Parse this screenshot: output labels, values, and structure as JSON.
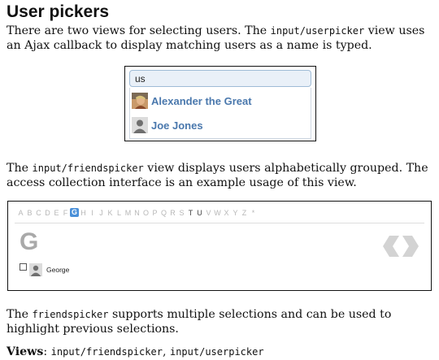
{
  "section": {
    "title": "User pickers"
  },
  "intro": {
    "before_code": "There are two views for selecting users. The ",
    "code": "input/userpicker",
    "after_code": " view uses an Ajax callback to display matching users as a name is typed."
  },
  "userpicker": {
    "input_value": "us",
    "results": [
      {
        "name": "Alexander the Great",
        "avatar": "profile-photo"
      },
      {
        "name": "Joe Jones",
        "avatar": "default-user-silhouette"
      }
    ]
  },
  "friendspicker_desc": {
    "before_code": "The ",
    "code": "input/friendspicker",
    "after_code": " view displays users alphabetically grouped. The access collection interface is an example usage of this view."
  },
  "friendspicker": {
    "letters": [
      {
        "label": "A",
        "state": "empty"
      },
      {
        "label": "B",
        "state": "empty"
      },
      {
        "label": "C",
        "state": "empty"
      },
      {
        "label": "D",
        "state": "empty"
      },
      {
        "label": "E",
        "state": "empty"
      },
      {
        "label": "F",
        "state": "empty"
      },
      {
        "label": "G",
        "state": "active"
      },
      {
        "label": "H",
        "state": "empty"
      },
      {
        "label": "I",
        "state": "empty"
      },
      {
        "label": "J",
        "state": "empty"
      },
      {
        "label": "K",
        "state": "empty"
      },
      {
        "label": "L",
        "state": "empty"
      },
      {
        "label": "M",
        "state": "empty"
      },
      {
        "label": "N",
        "state": "empty"
      },
      {
        "label": "O",
        "state": "empty"
      },
      {
        "label": "P",
        "state": "empty"
      },
      {
        "label": "Q",
        "state": "empty"
      },
      {
        "label": "R",
        "state": "empty"
      },
      {
        "label": "S",
        "state": "empty"
      },
      {
        "label": "T",
        "state": "has"
      },
      {
        "label": "U",
        "state": "has"
      },
      {
        "label": "V",
        "state": "empty"
      },
      {
        "label": "W",
        "state": "empty"
      },
      {
        "label": "X",
        "state": "empty"
      },
      {
        "label": "Y",
        "state": "empty"
      },
      {
        "label": "Z",
        "state": "empty"
      },
      {
        "label": "*",
        "state": "empty"
      }
    ],
    "current_letter": "G",
    "friend": {
      "name": "George",
      "checked": false,
      "avatar": "default-user-silhouette"
    },
    "nav_icon": "prev-next-arrows-icon",
    "colors": {
      "active_letter_bg": "#4a90d9",
      "link": "#4a78ad"
    }
  },
  "closing": {
    "before_code": "The ",
    "code": "friendspicker",
    "after_code": " supports multiple selections and can be used to highlight previous selections."
  },
  "views": {
    "label": "Views",
    "separator": ": ",
    "items": [
      "input/friendspicker",
      "input/userpicker"
    ],
    "join": ", "
  }
}
